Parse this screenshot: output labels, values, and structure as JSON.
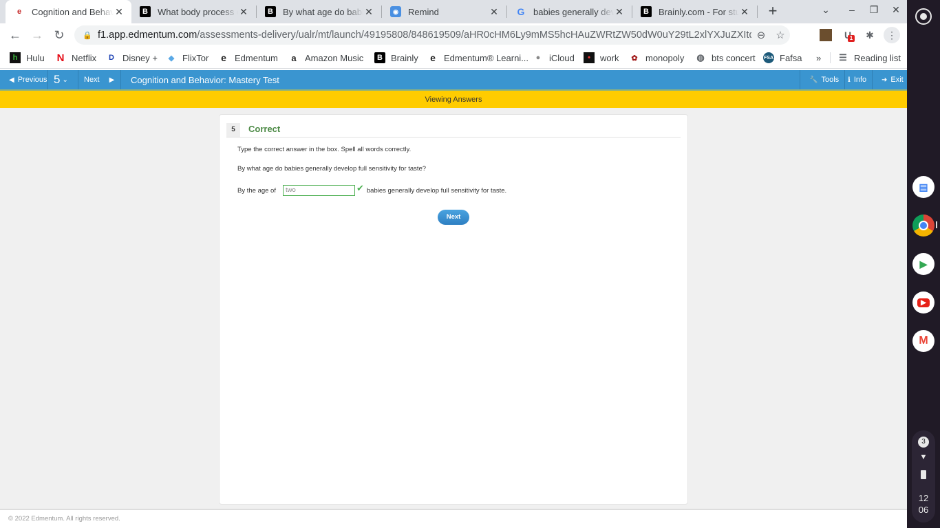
{
  "browser": {
    "tabs": [
      {
        "title": "Cognition and Behavior: Mastery Test",
        "favicon": "edmentum-icon",
        "active": true
      },
      {
        "title": "What body process could",
        "favicon": "brainly-icon",
        "active": false
      },
      {
        "title": "By what age do babies",
        "favicon": "brainly-icon",
        "active": false
      },
      {
        "title": "Remind",
        "favicon": "remind-icon",
        "active": false
      },
      {
        "title": "babies generally develop",
        "favicon": "google-icon",
        "active": false
      },
      {
        "title": "Brainly.com - For students",
        "favicon": "brainly-icon",
        "active": false
      }
    ],
    "url_host": "f1.app.edmentum.com",
    "url_path": "/assessments-delivery/ualr/mt/launch/49195808/848619509/aHR0cHM6Ly9mMS5hcHAuZWRtZW50dW0uY29tL2xlYXJuZXItdW...",
    "extension_badge": "1",
    "bookmarks": [
      {
        "label": "Hulu",
        "icon": "hulu-icon"
      },
      {
        "label": "Netflix",
        "icon": "netflix-icon"
      },
      {
        "label": "Disney +",
        "icon": "disney-icon"
      },
      {
        "label": "FlixTor",
        "icon": "flixtor-icon"
      },
      {
        "label": "Edmentum",
        "icon": "edmentum-icon"
      },
      {
        "label": "Amazon Music",
        "icon": "amazon-icon"
      },
      {
        "label": "Brainly",
        "icon": "brainly-icon"
      },
      {
        "label": "Edmentum® Learni...",
        "icon": "edmentum-icon"
      },
      {
        "label": "iCloud",
        "icon": "apple-icon"
      },
      {
        "label": "work",
        "icon": "work-icon"
      },
      {
        "label": "monopoly",
        "icon": "monopoly-icon"
      },
      {
        "label": "bts concert",
        "icon": "globe-icon"
      },
      {
        "label": "Fafsa",
        "icon": "fafsa-icon"
      }
    ],
    "overflow_label": "»",
    "reading_list_label": "Reading list"
  },
  "app": {
    "previous_label": "Previous",
    "question_number": "5",
    "next_label": "Next",
    "title": "Cognition and Behavior: Mastery Test",
    "tools_label": "Tools",
    "info_label": "Info",
    "exit_label": "Exit",
    "mode_banner": "Viewing Answers"
  },
  "question": {
    "number": "5",
    "status": "Correct",
    "instructions": "Type the correct answer in the box. Spell all words correctly.",
    "prompt": "By what age do babies generally develop full sensitivity for taste?",
    "prefix": "By the age of",
    "answer": "two",
    "suffix": "babies generally develop full sensitivity for taste.",
    "next_button": "Next"
  },
  "footer": {
    "copyright": "© 2022 Edmentum. All rights reserved."
  },
  "shelf": {
    "notification_count": "3",
    "clock_hour": "12",
    "clock_minute": "06"
  }
}
